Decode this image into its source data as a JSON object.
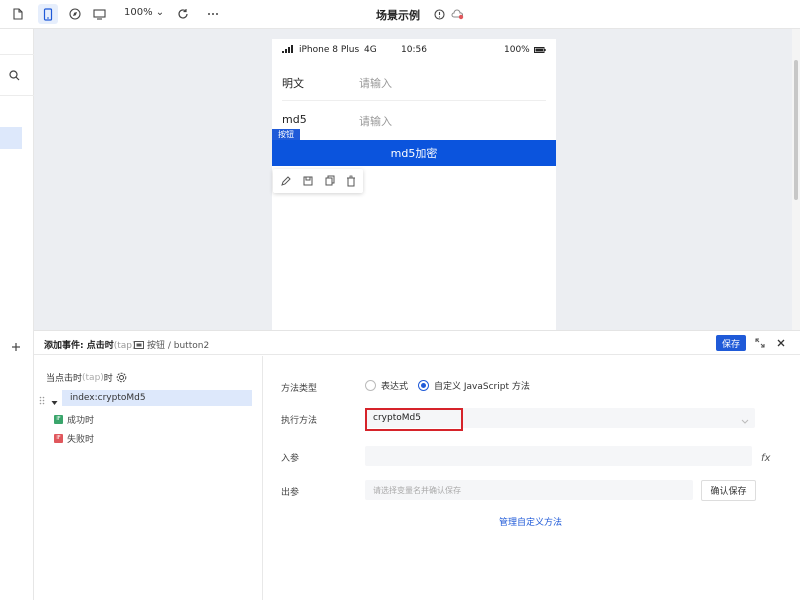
{
  "toolbar": {
    "zoom": "100%",
    "title": "场景示例"
  },
  "phone": {
    "status": {
      "carrier": "iPhone 8 Plus",
      "network": "4G",
      "time": "10:56",
      "battery": "100%"
    },
    "rows": [
      {
        "label": "明文",
        "placeholder": "请输入"
      },
      {
        "label": "md5",
        "placeholder": "请输入"
      }
    ],
    "button_tag": "按钮",
    "button_label": "md5加密"
  },
  "panel": {
    "title_prefix": "添加事件: 点击时",
    "title_suffix": "(tap)",
    "component_path": "按钮 / button2",
    "save_label": "保存",
    "event_head_prefix": "当点击时",
    "event_head_tap": "(tap)",
    "event_head_suffix": "时",
    "event_item": "index:cryptoMd5",
    "sub_events": [
      {
        "badge": "IF",
        "label": "成功时",
        "color": "#3aa56b"
      },
      {
        "badge": "IF",
        "label": "失败时",
        "color": "#e0575c"
      }
    ]
  },
  "form": {
    "method_type_label": "方法类型",
    "option_expression": "表达式",
    "option_custom_js": "自定义 JavaScript 方法",
    "selected_option": "custom_js",
    "exec_method_label": "执行方法",
    "exec_method_value": "cryptoMd5",
    "input_label": "入参",
    "fx": "fx",
    "output_label": "出参",
    "output_placeholder": "请选择变量名并确认保存",
    "confirm_save": "确认保存",
    "manage_link": "管理自定义方法"
  },
  "colors": {
    "accent": "#1f5ad8",
    "button": "#0b54dd",
    "highlight_box": "#d6232a"
  }
}
